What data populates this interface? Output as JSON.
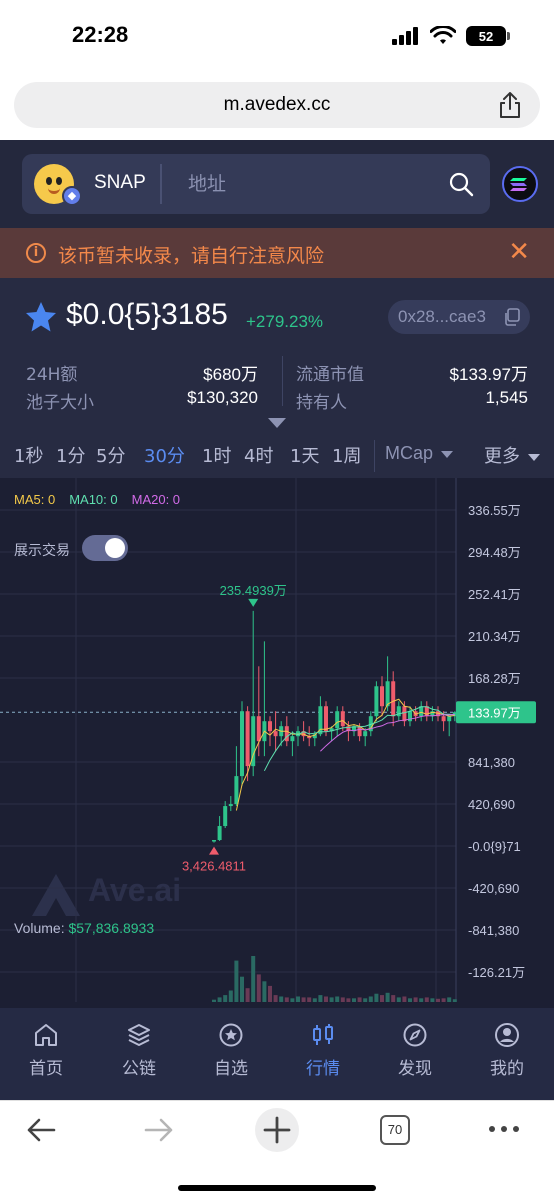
{
  "status_bar": {
    "time": "22:28",
    "battery": "52"
  },
  "browser": {
    "url": "m.avedex.cc",
    "tab_count": "70"
  },
  "search": {
    "token_symbol": "SNAP",
    "placeholder": "地址"
  },
  "warning": {
    "text": "该币暂未收录，请自行注意风险"
  },
  "token": {
    "price": "$0.0{5}3185",
    "change": "+279.23%",
    "address": "0x28...cae3"
  },
  "stats": {
    "vol_24h_label": "24H额",
    "vol_24h_value": "$680万",
    "pool_label": "池子大小",
    "pool_value": "$130,320",
    "mcap_label": "流通市值",
    "mcap_value": "$133.97万",
    "holders_label": "持有人",
    "holders_value": "1,545"
  },
  "intervals": [
    "1秒",
    "1分",
    "5分",
    "30分",
    "1时",
    "4时",
    "1天",
    "1周"
  ],
  "active_interval": "30分",
  "mcap_select": "MCap",
  "more_label": "更多",
  "show_trades_label": "展示交易",
  "chart_data": {
    "type": "candlestick",
    "title": "",
    "legend": [
      "MA5: 0",
      "MA10: 0",
      "MA20: 0"
    ],
    "y_tick_labels": [
      "336.55万",
      "294.48万",
      "252.41万",
      "210.34万",
      "168.28万",
      "133.97万",
      "841,380",
      "420,690",
      "-0.0{9}71",
      "-420,690",
      "-841,380",
      "-126.21万"
    ],
    "current_value_label": "133.97万",
    "max_label": "235.4939万",
    "min_label": "3,426.4811",
    "volume_label": "Volume:",
    "volume_value": "$57,836.8933",
    "watermark": "Ave.ai",
    "colors": {
      "up": "#2ec48b",
      "down": "#ef5c6c",
      "ma5": "#f3c94a",
      "ma10": "#5fe0b0",
      "ma20": "#d26be8"
    },
    "candles": [
      {
        "o": 0.5,
        "h": 0.6,
        "l": 0.34,
        "c": 0.6
      },
      {
        "o": 0.6,
        "h": 3.0,
        "l": 0.5,
        "c": 2.0
      },
      {
        "o": 2.0,
        "h": 4.5,
        "l": 1.8,
        "c": 4.0
      },
      {
        "o": 4.0,
        "h": 5.0,
        "l": 3.5,
        "c": 4.2
      },
      {
        "o": 4.2,
        "h": 10.0,
        "l": 4.0,
        "c": 7.0
      },
      {
        "o": 7.0,
        "h": 14.5,
        "l": 6.0,
        "c": 13.5
      },
      {
        "o": 13.5,
        "h": 14.0,
        "l": 6.5,
        "c": 8.0
      },
      {
        "o": 8.0,
        "h": 23.55,
        "l": 7.0,
        "c": 13.0
      },
      {
        "o": 13.0,
        "h": 18.0,
        "l": 9.0,
        "c": 10.5
      },
      {
        "o": 10.5,
        "h": 20.5,
        "l": 9.0,
        "c": 12.5
      },
      {
        "o": 12.5,
        "h": 13.0,
        "l": 10.0,
        "c": 11.5
      },
      {
        "o": 11.5,
        "h": 13.5,
        "l": 9.5,
        "c": 11.0
      },
      {
        "o": 11.0,
        "h": 12.5,
        "l": 10.0,
        "c": 12.0
      },
      {
        "o": 12.0,
        "h": 13.0,
        "l": 10.0,
        "c": 10.5
      },
      {
        "o": 10.5,
        "h": 11.5,
        "l": 9.0,
        "c": 11.0
      },
      {
        "o": 11.0,
        "h": 12.0,
        "l": 10.0,
        "c": 11.5
      },
      {
        "o": 11.5,
        "h": 12.5,
        "l": 10.5,
        "c": 11.0
      },
      {
        "o": 11.0,
        "h": 12.0,
        "l": 10.0,
        "c": 10.8
      },
      {
        "o": 10.8,
        "h": 11.5,
        "l": 10.0,
        "c": 11.2
      },
      {
        "o": 11.2,
        "h": 15.0,
        "l": 11.0,
        "c": 14.0
      },
      {
        "o": 14.0,
        "h": 14.5,
        "l": 11.0,
        "c": 11.5
      },
      {
        "o": 11.5,
        "h": 12.0,
        "l": 10.5,
        "c": 11.8
      },
      {
        "o": 11.8,
        "h": 14.0,
        "l": 11.0,
        "c": 13.5
      },
      {
        "o": 13.5,
        "h": 14.0,
        "l": 11.5,
        "c": 12.0
      },
      {
        "o": 12.0,
        "h": 12.5,
        "l": 10.5,
        "c": 11.5
      },
      {
        "o": 11.5,
        "h": 12.2,
        "l": 11.0,
        "c": 12.0
      },
      {
        "o": 12.0,
        "h": 12.3,
        "l": 10.5,
        "c": 11.0
      },
      {
        "o": 11.0,
        "h": 11.8,
        "l": 10.0,
        "c": 11.5
      },
      {
        "o": 11.5,
        "h": 13.5,
        "l": 11.0,
        "c": 13.0
      },
      {
        "o": 13.0,
        "h": 16.5,
        "l": 12.5,
        "c": 16.0
      },
      {
        "o": 16.0,
        "h": 17.0,
        "l": 13.0,
        "c": 14.0
      },
      {
        "o": 14.0,
        "h": 19.0,
        "l": 13.5,
        "c": 16.5
      },
      {
        "o": 16.5,
        "h": 17.5,
        "l": 12.0,
        "c": 13.0
      },
      {
        "o": 13.0,
        "h": 14.5,
        "l": 12.5,
        "c": 14.0
      },
      {
        "o": 14.0,
        "h": 14.5,
        "l": 12.0,
        "c": 12.5
      },
      {
        "o": 12.5,
        "h": 14.0,
        "l": 12.0,
        "c": 13.5
      },
      {
        "o": 13.5,
        "h": 14.0,
        "l": 12.5,
        "c": 13.0
      },
      {
        "o": 13.0,
        "h": 14.5,
        "l": 12.5,
        "c": 14.0
      },
      {
        "o": 14.0,
        "h": 14.5,
        "l": 12.5,
        "c": 13.0
      },
      {
        "o": 13.0,
        "h": 14.0,
        "l": 12.5,
        "c": 13.5
      },
      {
        "o": 13.5,
        "h": 14.0,
        "l": 12.5,
        "c": 13.0
      },
      {
        "o": 13.0,
        "h": 13.5,
        "l": 11.5,
        "c": 12.5
      },
      {
        "o": 12.5,
        "h": 13.0,
        "l": 11.0,
        "c": 13.0
      },
      {
        "o": 13.0,
        "h": 13.5,
        "l": 12.5,
        "c": 13.4
      }
    ],
    "volumes": [
      0.05,
      0.1,
      0.15,
      0.25,
      0.9,
      0.55,
      0.3,
      1.0,
      0.6,
      0.45,
      0.35,
      0.15,
      0.12,
      0.1,
      0.08,
      0.12,
      0.1,
      0.1,
      0.08,
      0.15,
      0.12,
      0.1,
      0.12,
      0.1,
      0.08,
      0.08,
      0.1,
      0.08,
      0.12,
      0.18,
      0.15,
      0.2,
      0.15,
      0.1,
      0.12,
      0.08,
      0.1,
      0.08,
      0.1,
      0.08,
      0.07,
      0.08,
      0.1,
      0.06
    ]
  },
  "nav": [
    {
      "label": "首页",
      "icon": "home-icon"
    },
    {
      "label": "公链",
      "icon": "layers-icon"
    },
    {
      "label": "自选",
      "icon": "star-circle-icon"
    },
    {
      "label": "行情",
      "icon": "candles-icon"
    },
    {
      "label": "发现",
      "icon": "compass-icon"
    },
    {
      "label": "我的",
      "icon": "user-icon"
    }
  ],
  "active_nav": "行情"
}
